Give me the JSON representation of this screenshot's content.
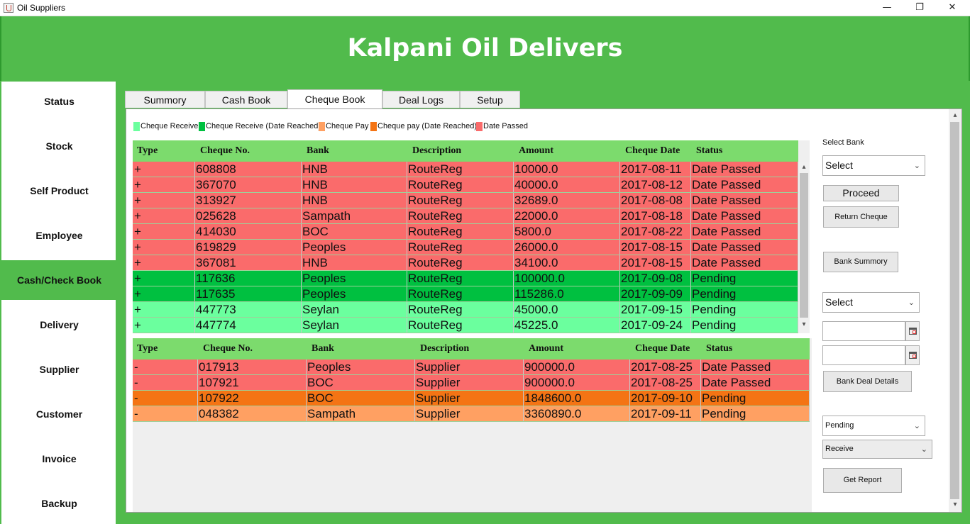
{
  "window": {
    "title": "Oil Suppliers",
    "minimize_glyph": "—",
    "maximize_glyph": "❐",
    "close_glyph": "✕"
  },
  "header": {
    "title": "Kalpani Oil Delivers"
  },
  "sidebar": {
    "items": [
      {
        "label": "Status"
      },
      {
        "label": "Stock"
      },
      {
        "label": "Self Product"
      },
      {
        "label": "Employee"
      },
      {
        "label": "Cash/Check Book",
        "active": true
      },
      {
        "label": "Delivery"
      },
      {
        "label": "Supplier"
      },
      {
        "label": "Customer"
      },
      {
        "label": "Invoice"
      },
      {
        "label": "Backup"
      }
    ]
  },
  "tabs": [
    {
      "label": "Summory"
    },
    {
      "label": "Cash Book"
    },
    {
      "label": "Cheque Book",
      "active": true
    },
    {
      "label": "Deal Logs"
    },
    {
      "label": "Setup"
    }
  ],
  "legend": [
    {
      "label": "Cheque Receive",
      "color": "#6bff9e"
    },
    {
      "label": "Cheque Receive (Date Reached)",
      "color": "#00c040"
    },
    {
      "label": "Cheque Pay",
      "color": "#ffa062"
    },
    {
      "label": "Cheque pay (Date Reached)",
      "color": "#f47414"
    },
    {
      "label": "Date Passed",
      "color": "#fa6b6b"
    }
  ],
  "receive_table": {
    "columns": [
      "Type",
      "Cheque No.",
      "Bank",
      "Description",
      "Amount",
      "Cheque Date",
      "Status"
    ],
    "rows": [
      {
        "cells": [
          "+",
          "608808",
          "HNB",
          "RouteReg",
          "10000.0",
          "2017-08-11",
          "Date Passed"
        ],
        "color": "#fa6b6b"
      },
      {
        "cells": [
          "+",
          "367070",
          "HNB",
          "RouteReg",
          "40000.0",
          "2017-08-12",
          "Date Passed"
        ],
        "color": "#fa6b6b"
      },
      {
        "cells": [
          "+",
          "313927",
          "HNB",
          "RouteReg",
          "32689.0",
          "2017-08-08",
          "Date Passed"
        ],
        "color": "#fa6b6b"
      },
      {
        "cells": [
          "+",
          "025628",
          "Sampath",
          "RouteReg",
          "22000.0",
          "2017-08-18",
          "Date Passed"
        ],
        "color": "#fa6b6b"
      },
      {
        "cells": [
          "+",
          "414030",
          "BOC",
          "RouteReg",
          "5800.0",
          "2017-08-22",
          "Date Passed"
        ],
        "color": "#fa6b6b"
      },
      {
        "cells": [
          "+",
          "619829",
          "Peoples",
          "RouteReg",
          "26000.0",
          "2017-08-15",
          "Date Passed"
        ],
        "color": "#fa6b6b"
      },
      {
        "cells": [
          "+",
          "367081",
          "HNB",
          "RouteReg",
          "34100.0",
          "2017-08-15",
          "Date Passed"
        ],
        "color": "#fa6b6b"
      },
      {
        "cells": [
          "+",
          "117636",
          "Peoples",
          "RouteReg",
          "100000.0",
          "2017-09-08",
          "Pending"
        ],
        "color": "#00c040"
      },
      {
        "cells": [
          "+",
          "117635",
          "Peoples",
          "RouteReg",
          "115286.0",
          "2017-09-09",
          "Pending"
        ],
        "color": "#00c040"
      },
      {
        "cells": [
          "+",
          "447773",
          "Seylan",
          "RouteReg",
          "45000.0",
          "2017-09-15",
          "Pending"
        ],
        "color": "#6bff9e"
      },
      {
        "cells": [
          "+",
          "447774",
          "Seylan",
          "RouteReg",
          "45225.0",
          "2017-09-24",
          "Pending"
        ],
        "color": "#6bff9e"
      }
    ]
  },
  "pay_table": {
    "columns": [
      "Type",
      "Cheque No.",
      "Bank",
      "Description",
      "Amount",
      "Cheque Date",
      "Status"
    ],
    "rows": [
      {
        "cells": [
          "-",
          "017913",
          "Peoples",
          "Supplier",
          "900000.0",
          "2017-08-25",
          "Date Passed"
        ],
        "color": "#fa6b6b"
      },
      {
        "cells": [
          "-",
          "107921",
          "BOC",
          "Supplier",
          "900000.0",
          "2017-08-25",
          "Date Passed"
        ],
        "color": "#fa6b6b"
      },
      {
        "cells": [
          "-",
          "107922",
          "BOC",
          "Supplier",
          "1848600.0",
          "2017-09-10",
          "Pending"
        ],
        "color": "#f47414"
      },
      {
        "cells": [
          "-",
          "048382",
          "Sampath",
          "Supplier",
          "3360890.0",
          "2017-09-11",
          "Pending"
        ],
        "color": "#ffa062"
      }
    ]
  },
  "controls": {
    "select_bank_label": "Select Bank",
    "bank_select_value": "Select",
    "proceed_label": "Proceed",
    "return_cheque_label": "Return Cheque",
    "bank_summary_label": "Bank Summory",
    "period_select_value": "Select",
    "bank_deal_details_label": "Bank Deal Details",
    "status_select_value": "Pending",
    "type_select_value": "Receive",
    "get_report_label": "Get Report"
  },
  "icons": {
    "chevron": "chevron-down-icon",
    "scroll_up": "▴",
    "scroll_down": "▾",
    "dropdown": "⌄"
  }
}
